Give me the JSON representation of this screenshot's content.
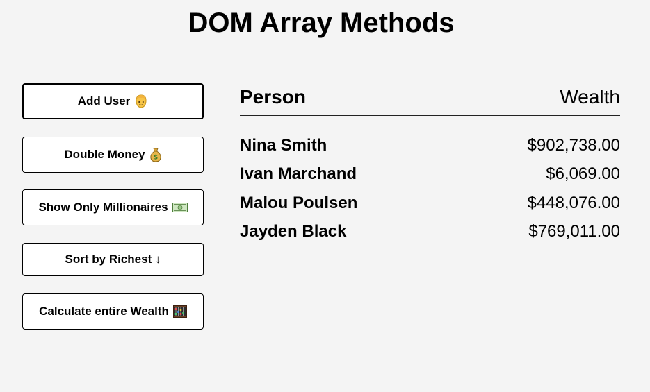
{
  "title": "DOM Array Methods",
  "buttons": [
    {
      "label": "Add User",
      "icon": "person-icon"
    },
    {
      "label": "Double Money",
      "icon": "money-bag-icon"
    },
    {
      "label": "Show Only Millionaires",
      "icon": "banknote-icon"
    },
    {
      "label": "Sort by Richest ↓",
      "icon": ""
    },
    {
      "label": "Calculate entire Wealth",
      "icon": "abacus-icon"
    }
  ],
  "table": {
    "header_person": "Person",
    "header_wealth": "Wealth",
    "rows": [
      {
        "name": "Nina Smith",
        "wealth": "$902,738.00"
      },
      {
        "name": "Ivan Marchand",
        "wealth": "$6,069.00"
      },
      {
        "name": "Malou Poulsen",
        "wealth": "$448,076.00"
      },
      {
        "name": "Jayden Black",
        "wealth": "$769,011.00"
      }
    ]
  },
  "colors": {
    "background": "#f4f4f4",
    "button_bg": "#ffffff",
    "border": "#000000"
  }
}
